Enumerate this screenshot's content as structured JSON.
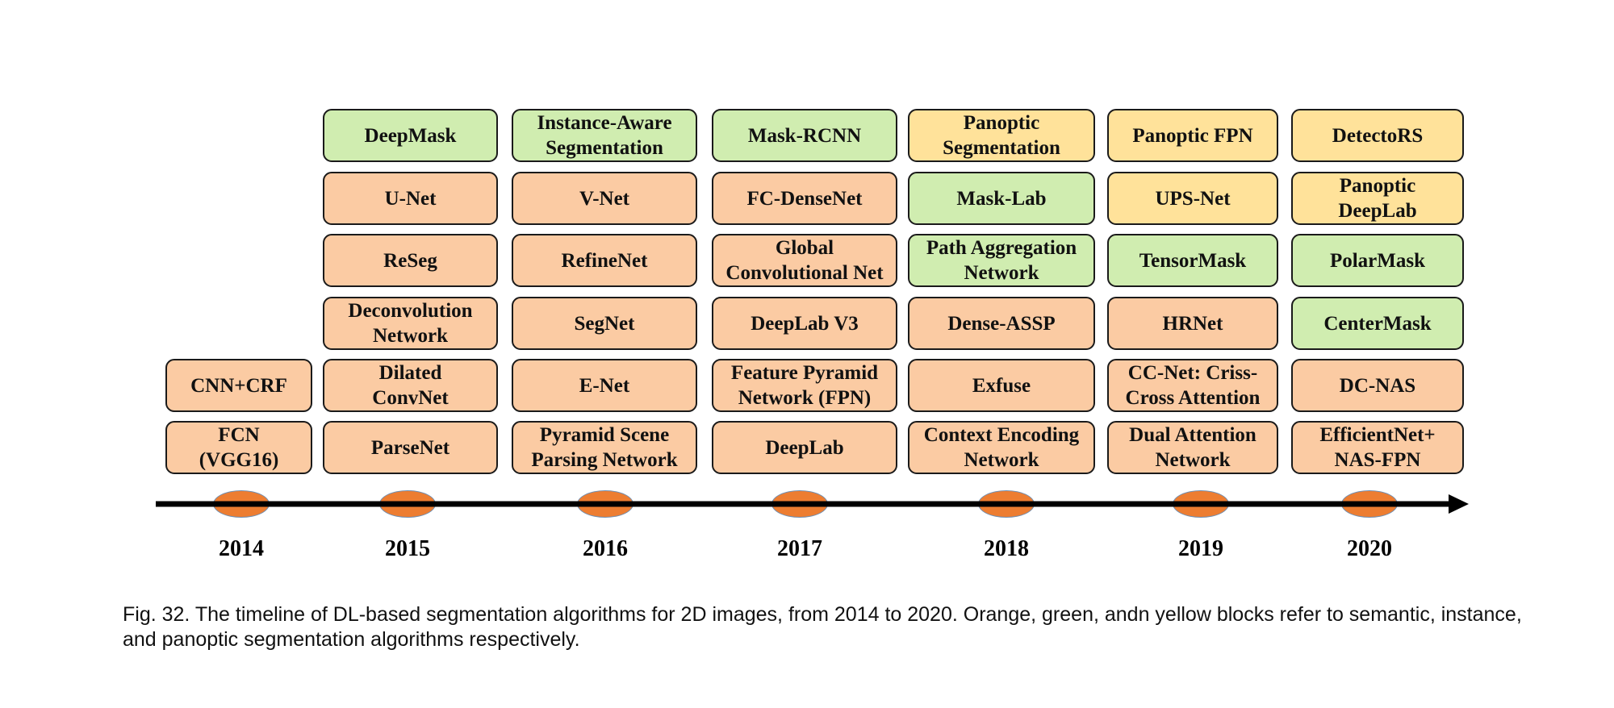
{
  "legend": {
    "semantic": {
      "label": "semantic",
      "color": "#FBCBA3"
    },
    "instance": {
      "label": "instance",
      "color": "#D0EDB0"
    },
    "panoptic": {
      "label": "panoptic",
      "color": "#FFE29A"
    }
  },
  "timeline": {
    "dot_color": "#ED7D31",
    "years": [
      {
        "year": "2014",
        "blocks": [
          {
            "label": "CNN+CRF",
            "type": "semantic"
          },
          {
            "label": "FCN\n(VGG16)",
            "type": "semantic"
          }
        ]
      },
      {
        "year": "2015",
        "blocks": [
          {
            "label": "DeepMask",
            "type": "instance"
          },
          {
            "label": "U-Net",
            "type": "semantic"
          },
          {
            "label": "ReSeg",
            "type": "semantic"
          },
          {
            "label": "Deconvolution\nNetwork",
            "type": "semantic"
          },
          {
            "label": "Dilated\nConvNet",
            "type": "semantic"
          },
          {
            "label": "ParseNet",
            "type": "semantic"
          }
        ]
      },
      {
        "year": "2016",
        "blocks": [
          {
            "label": "Instance-Aware\nSegmentation",
            "type": "instance"
          },
          {
            "label": "V-Net",
            "type": "semantic"
          },
          {
            "label": "RefineNet",
            "type": "semantic"
          },
          {
            "label": "SegNet",
            "type": "semantic"
          },
          {
            "label": "E-Net",
            "type": "semantic"
          },
          {
            "label": "Pyramid Scene\nParsing Network",
            "type": "semantic"
          }
        ]
      },
      {
        "year": "2017",
        "blocks": [
          {
            "label": "Mask-RCNN",
            "type": "instance"
          },
          {
            "label": "FC-DenseNet",
            "type": "semantic"
          },
          {
            "label": "Global\nConvolutional Net",
            "type": "semantic"
          },
          {
            "label": "DeepLab V3",
            "type": "semantic"
          },
          {
            "label": "Feature Pyramid\nNetwork (FPN)",
            "type": "semantic"
          },
          {
            "label": "DeepLab",
            "type": "semantic"
          }
        ]
      },
      {
        "year": "2018",
        "blocks": [
          {
            "label": "Panoptic\nSegmentation",
            "type": "panoptic"
          },
          {
            "label": "Mask-Lab",
            "type": "instance"
          },
          {
            "label": "Path Aggregation\nNetwork",
            "type": "instance"
          },
          {
            "label": "Dense-ASSP",
            "type": "semantic"
          },
          {
            "label": "Exfuse",
            "type": "semantic"
          },
          {
            "label": "Context Encoding\nNetwork",
            "type": "semantic"
          }
        ]
      },
      {
        "year": "2019",
        "blocks": [
          {
            "label": "Panoptic FPN",
            "type": "panoptic"
          },
          {
            "label": "UPS-Net",
            "type": "panoptic"
          },
          {
            "label": "TensorMask",
            "type": "instance"
          },
          {
            "label": "HRNet",
            "type": "semantic"
          },
          {
            "label": "CC-Net: Criss-\nCross Attention",
            "type": "semantic"
          },
          {
            "label": "Dual Attention\nNetwork",
            "type": "semantic"
          }
        ]
      },
      {
        "year": "2020",
        "blocks": [
          {
            "label": "DetectoRS",
            "type": "panoptic"
          },
          {
            "label": "Panoptic\nDeepLab",
            "type": "panoptic"
          },
          {
            "label": "PolarMask",
            "type": "instance"
          },
          {
            "label": "CenterMask",
            "type": "instance"
          },
          {
            "label": "DC-NAS",
            "type": "semantic"
          },
          {
            "label": "EfficientNet+\nNAS-FPN",
            "type": "semantic"
          }
        ]
      }
    ]
  },
  "caption": "Fig. 32. The timeline of DL-based segmentation algorithms for 2D images, from 2014 to 2020. Orange, green, andn yellow blocks refer to semantic, instance, and panoptic segmentation algorithms respectively."
}
